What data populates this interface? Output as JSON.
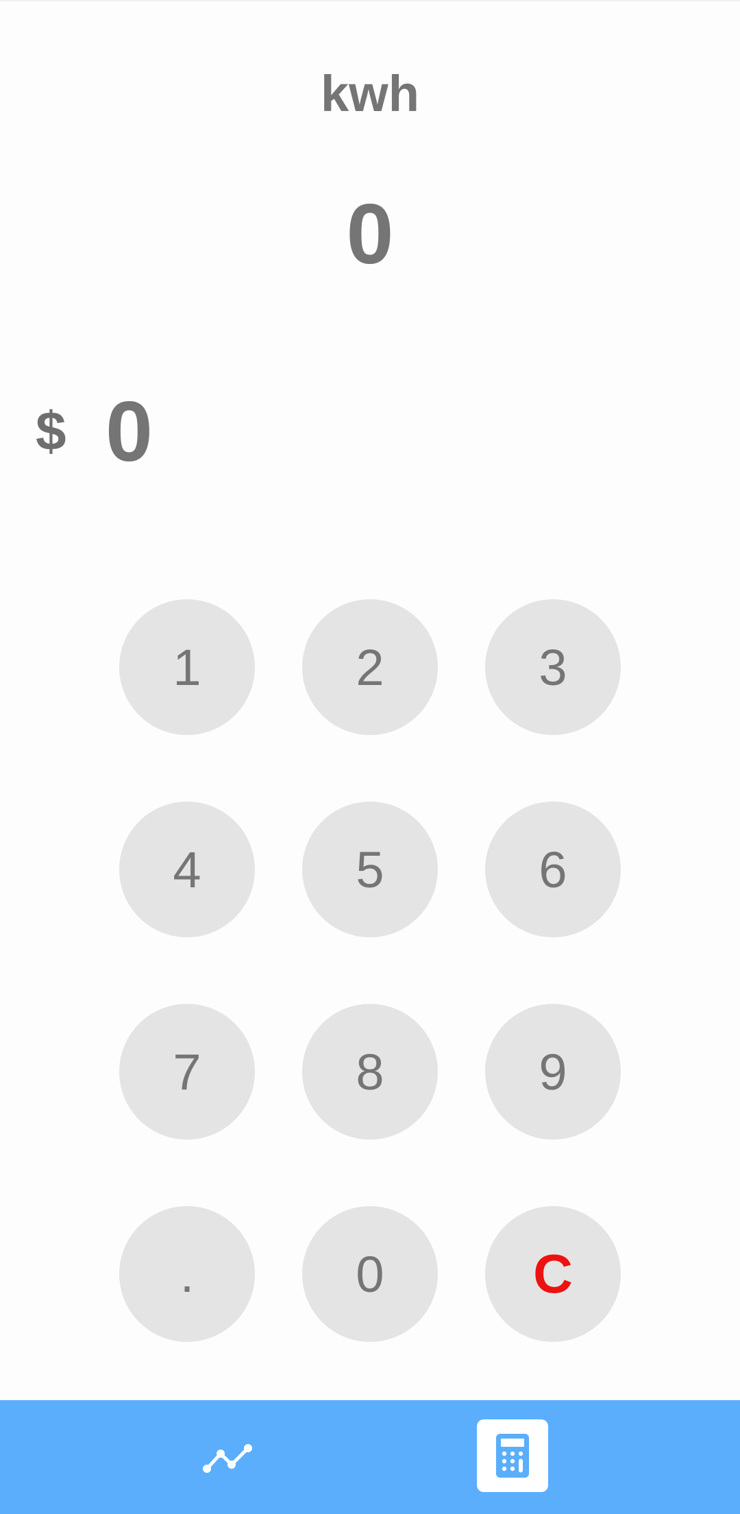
{
  "header": {
    "unit_title": "kwh",
    "kwh_value": "0"
  },
  "cost": {
    "currency_symbol": "$",
    "value": "0"
  },
  "keypad": {
    "keys": [
      "1",
      "2",
      "3",
      "4",
      "5",
      "6",
      "7",
      "8",
      "9",
      ".",
      "0",
      "C"
    ]
  },
  "bottom_nav": {
    "items": [
      {
        "icon": "line-chart-icon",
        "active": false
      },
      {
        "icon": "calculator-icon",
        "active": true
      }
    ]
  },
  "colors": {
    "nav_background": "#5aaefc",
    "key_background": "#e4e4e4",
    "text": "#757575",
    "clear_key": "#ee1111"
  }
}
